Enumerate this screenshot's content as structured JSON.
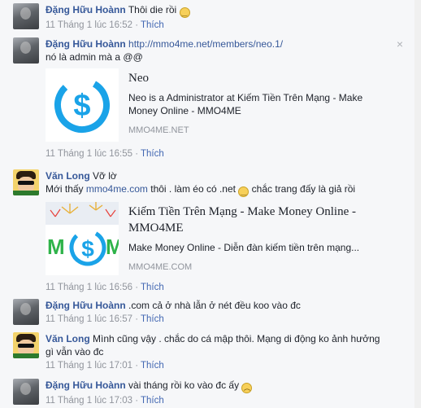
{
  "comments": [
    {
      "author": "Đặng Hữu Hoànn",
      "text": "Thôi die rồi",
      "time": "11 Tháng 1 lúc 16:52",
      "like": "Thích",
      "emoji": "smirk"
    },
    {
      "author": "Đặng Hữu Hoànn",
      "link": "http://mmo4me.net/members/neo.1/",
      "text": "nó là admin mà a @@",
      "time": "11 Tháng 1 lúc 16:55",
      "like": "Thích",
      "close": "×",
      "card": {
        "title": "Neo",
        "desc": "Neo is a Administrator at Kiếm Tiền Trên Mạng - Make Money Online - MMO4ME",
        "domain": "MMO4ME.NET"
      }
    },
    {
      "author": "Văn Long",
      "text": "Vỡ lờ",
      "line2_pre": "Mới thấy",
      "line2_link": "mmo4me.com",
      "line2_post": "thôi . làm éo có .net",
      "line2_tail": "chắc trang đấy là giả rồi",
      "time": "11 Tháng 1 lúc 16:56",
      "like": "Thích",
      "card": {
        "title": "Kiếm Tiền Trên Mạng - Make Money Online - MMO4ME",
        "desc": "Make Money Online - Diễn đàn kiếm tiền trên mạng...",
        "domain": "MMO4ME.COM"
      }
    },
    {
      "author": "Đặng Hữu Hoànn",
      "text": ".com cả ở nhà lẫn ở nét đều koo vào đc",
      "time": "11 Tháng 1 lúc 16:57",
      "like": "Thích"
    },
    {
      "author": "Văn Long",
      "text": "Mình cũng vậy . chắc do cá mập thôi. Mạng di động ko ảnh hưởng",
      "text2": "gì vẫn vào đc",
      "time": "11 Tháng 1 lúc 17:01",
      "like": "Thích"
    },
    {
      "author": "Đặng Hữu Hoànn",
      "text": "vài tháng rồi ko vào đc ấy",
      "time": "11 Tháng 1 lúc 17:03",
      "like": "Thích"
    }
  ],
  "icons": {
    "emoji_smirk": "smirk-emoji-icon",
    "emoji_frown": "frown-emoji-icon",
    "close": "close-icon",
    "dollar": "dollar-coin-icon"
  },
  "colors": {
    "author": "#365899",
    "meta": "#90949c",
    "brand": "#1aa3e8"
  }
}
